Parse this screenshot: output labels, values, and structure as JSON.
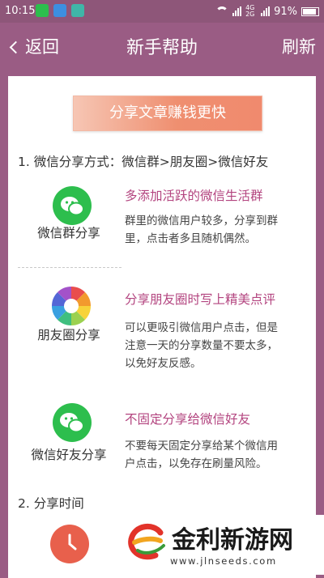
{
  "status_bar": {
    "time": "10:15",
    "battery_text": "91%",
    "network_label": "4G 2G",
    "battery_level": 0.91,
    "app_icons": [
      "wechat-icon",
      "message-icon",
      "app-icon"
    ]
  },
  "nav": {
    "back_label": "返回",
    "title": "新手帮助",
    "refresh_label": "刷新"
  },
  "banner": "分享文章赚钱更快",
  "section1": {
    "title": "1. 微信分享方式：微信群>朋友圈>微信好友",
    "items": [
      {
        "icon": "wechat-group-icon",
        "label": "微信群分享",
        "heading": "多添加活跃的微信生活群",
        "desc_lines": [
          "群里的微信用户较多，分享到群",
          "里，点击者多且随机偶然。"
        ]
      },
      {
        "icon": "moments-icon",
        "label": "朋友圈分享",
        "heading": "分享朋友圈时写上精美点评",
        "desc_lines": [
          "可以更吸引微信用户点击，但是",
          "注意一天的分享数量不要太多，",
          "以免好友反感。"
        ]
      },
      {
        "icon": "wechat-friend-icon",
        "label": "微信好友分享",
        "heading": "不固定分享给微信好友",
        "desc_lines": [
          "不要每天固定分享给某个微信用",
          "户点击，以免存在刷量风险。"
        ]
      }
    ]
  },
  "section2": {
    "title": "2. 分享时间",
    "icon": "clock-icon"
  },
  "watermark": {
    "name": "金利新游网",
    "url": "www.jlnseeds.com"
  },
  "colors": {
    "nav_bg": "#9a5c84",
    "heading": "#b3447f",
    "wechat_green": "#2dbe4d",
    "clock": "#e8604c"
  }
}
